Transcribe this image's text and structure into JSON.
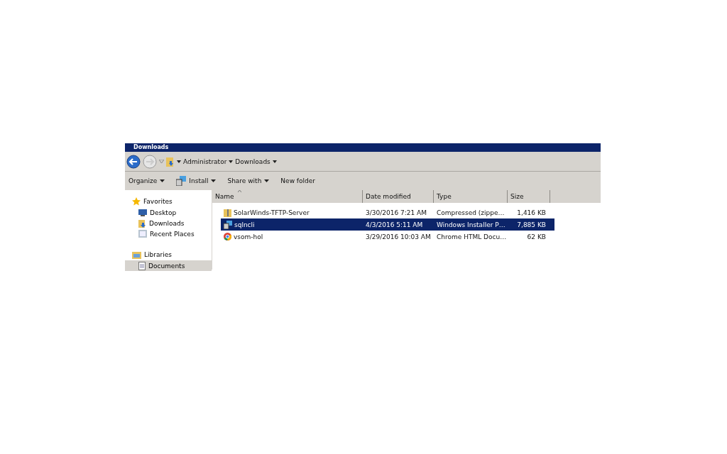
{
  "window": {
    "title": "Downloads"
  },
  "address": {
    "crumbs": [
      "Administrator",
      "Downloads"
    ]
  },
  "toolbar": [
    {
      "label": "Organize",
      "kind": "menu"
    },
    {
      "label": "Install",
      "kind": "install"
    },
    {
      "label": "Share with",
      "kind": "menu"
    },
    {
      "label": "New folder",
      "kind": "plain"
    }
  ],
  "sidebar": {
    "groups": [
      {
        "label": "Favorites",
        "kind": "star",
        "items": [
          {
            "label": "Desktop",
            "kind": "desktop",
            "selected": false
          },
          {
            "label": "Downloads",
            "kind": "downloads",
            "selected": false
          },
          {
            "label": "Recent Places",
            "kind": "recent",
            "selected": false
          }
        ]
      },
      {
        "label": "Libraries",
        "kind": "library",
        "items": [
          {
            "label": "Documents",
            "kind": "document",
            "selected": true
          }
        ]
      }
    ]
  },
  "table": {
    "columns": [
      {
        "label": "Name",
        "sorted": true
      },
      {
        "label": "Date modified",
        "sorted": false
      },
      {
        "label": "Type",
        "sorted": false
      },
      {
        "label": "Size",
        "sorted": false
      }
    ],
    "rows": [
      {
        "kind": "zip",
        "name": "SolarWinds-TFTP-Server",
        "date": "3/30/2016 7:21 AM",
        "type": "Compressed (zippe…",
        "size": "1,416 KB",
        "selected": false
      },
      {
        "kind": "installer",
        "name": "sqlncli",
        "date": "4/3/2016 5:11 AM",
        "type": "Windows Installer P…",
        "size": "7,885 KB",
        "selected": true
      },
      {
        "kind": "chrome",
        "name": "vsom-hol",
        "date": "3/29/2016 10:03 AM",
        "type": "Chrome HTML Docu…",
        "size": "62 KB",
        "selected": false
      }
    ]
  }
}
